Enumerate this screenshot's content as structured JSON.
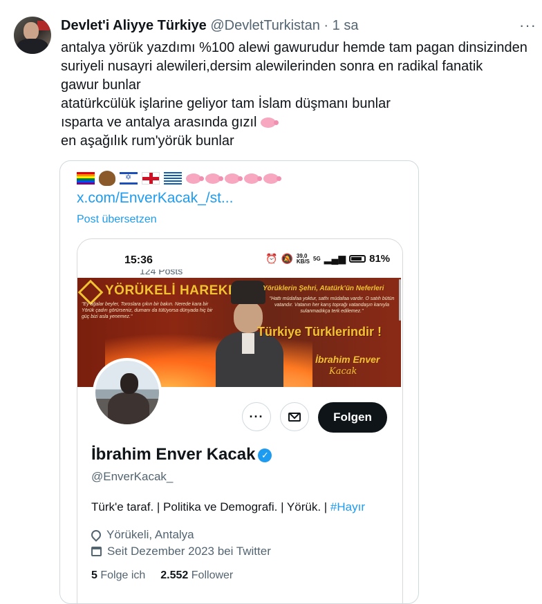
{
  "tweet": {
    "author_name": "Devlet'i Aliyye Türkiye",
    "author_handle": "@DevletTurkistan",
    "separator": "·",
    "time": "1 sa",
    "more_label": "···",
    "lines": [
      "antalya yörük yazdımı %100 alewi gawurudur hemde tam pagan dinsizinden",
      "suriyeli nusayri alewileri,dersim alewilerinden sonra en radikal fanatik",
      "gawur bunlar",
      "atatürkcülük işlarine geliyor tam İslam düşmanı bunlar",
      "ısparta ve antalya arasında gızıl",
      "en aşağılık rum'yörük bunlar"
    ],
    "pig_icon": "pig-emoji-icon"
  },
  "embed": {
    "link": "x.com/EnverKacak_/st...",
    "translate": "Post übersetzen",
    "emoji_icons": [
      "rainbow-flag-icon",
      "poop-icon",
      "israel-flag-icon",
      "england-flag-icon",
      "greece-flag-icon",
      "pig-emoji-icon",
      "pig-emoji-icon",
      "pig-emoji-icon",
      "pig-emoji-icon",
      "pig-emoji-icon"
    ]
  },
  "phone": {
    "clock": "15:36",
    "net_speed_top": "39,0",
    "net_speed_bottom": "KB/S",
    "net_type": "5G",
    "battery": "81%",
    "posts_peek": "124 Posts"
  },
  "banner": {
    "title": "YÖRÜKELİ HAREKETİ",
    "quote_left": "\"Ey ağalar beyler, Toroslara çıkın bir bakın. Nerede kara bir Yörük çadırı görürseniz, dumanı da tütüyorsa dünyada hiç bir güç bizi asla yenemez.\"",
    "right_title": "Yörüklerin Şehri, Atatürk'ün Neferleri",
    "right_quote": "\"Hattı müdafaa yoktur, sathı müdafaa vardır. O satıh bütün vatandır. Vatanın her karış toprağı vatandaşın kanıyla sulanmadıkça terk edilemez.\"",
    "motto": "Türkiye Türklerindir !",
    "sign_line1": "İbrahim Enver",
    "sign_line2": "Kacak"
  },
  "profile": {
    "name": "İbrahim Enver Kacak",
    "handle": "@EnverKacak_",
    "bio_text": "Türk'e taraf. | Politika ve Demografi. | Yörük. | ",
    "bio_hashtag": "#Hayır",
    "location": "Yörükeli, Antalya",
    "joined": "Seit Dezember 2023 bei Twitter",
    "following_count": "5",
    "following_label": "Folge ich",
    "followers_count": "2.552",
    "followers_label": "Follower",
    "follow_button": "Folgen",
    "more_button": "···"
  },
  "colors": {
    "accent": "#1d9bf0",
    "text": "#0f1419",
    "muted": "#536471",
    "banner_red": "#8c2712",
    "banner_gold": "#f1c232"
  }
}
